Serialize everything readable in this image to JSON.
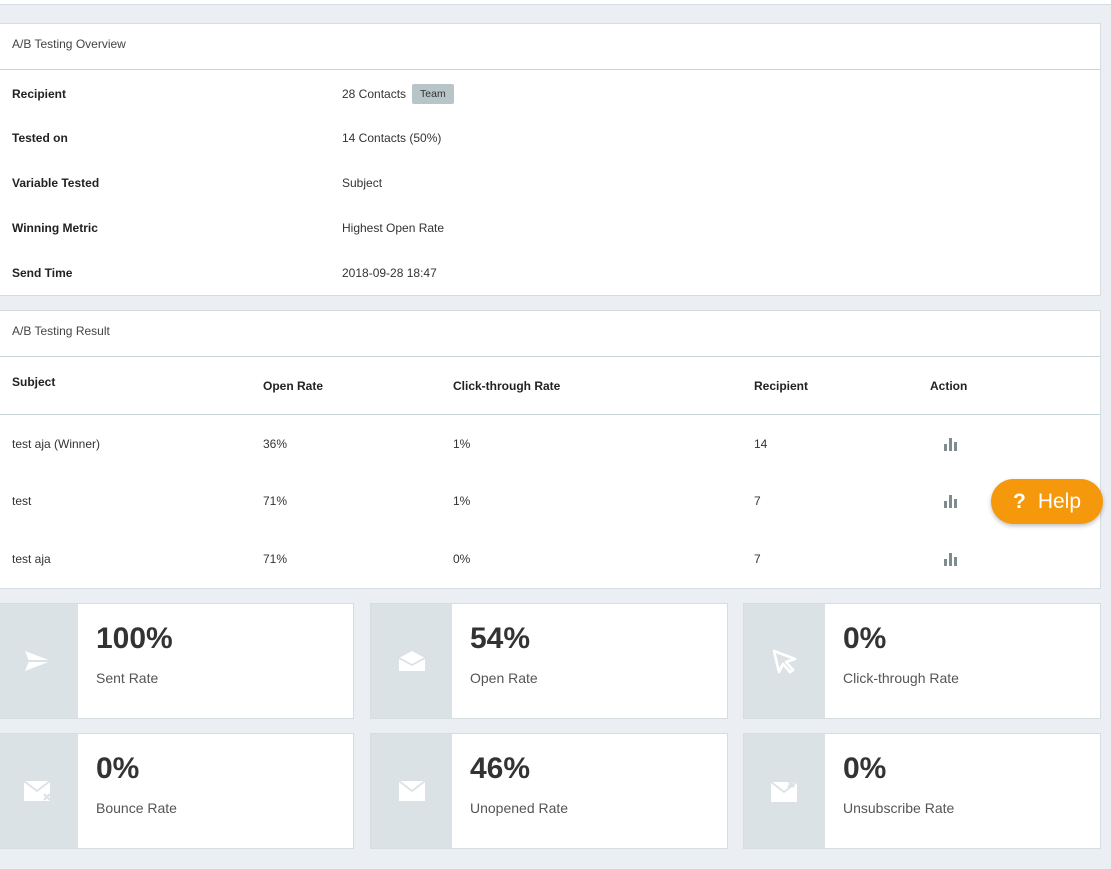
{
  "overview": {
    "title": "A/B Testing Overview",
    "rows": [
      {
        "label": "Recipient",
        "value": "28 Contacts",
        "badge": "Team"
      },
      {
        "label": "Tested on",
        "value": "14 Contacts (50%)"
      },
      {
        "label": "Variable Tested",
        "value": "Subject"
      },
      {
        "label": "Winning Metric",
        "value": "Highest Open Rate"
      },
      {
        "label": "Send Time",
        "value": "2018-09-28 18:47"
      }
    ]
  },
  "result": {
    "title": "A/B Testing Result",
    "columns": [
      "Subject",
      "Open Rate",
      "Click-through Rate",
      "Recipient",
      "Action"
    ],
    "rows": [
      {
        "subject": "test aja (Winner)",
        "open_rate": "36%",
        "ctr": "1%",
        "recipient": "14"
      },
      {
        "subject": "test",
        "open_rate": "71%",
        "ctr": "1%",
        "recipient": "7"
      },
      {
        "subject": "test aja",
        "open_rate": "71%",
        "ctr": "0%",
        "recipient": "7"
      }
    ]
  },
  "help": {
    "icon": "?",
    "label": "Help",
    "color": "#f5980b"
  },
  "stats": [
    {
      "value": "100%",
      "label": "Sent Rate",
      "icon": "paper-plane-icon"
    },
    {
      "value": "54%",
      "label": "Open Rate",
      "icon": "open-envelope-icon"
    },
    {
      "value": "0%",
      "label": "Click-through Rate",
      "icon": "cursor-icon"
    },
    {
      "value": "0%",
      "label": "Bounce Rate",
      "icon": "envelope-x-icon"
    },
    {
      "value": "46%",
      "label": "Unopened Rate",
      "icon": "envelope-icon"
    },
    {
      "value": "0%",
      "label": "Unsubscribe Rate",
      "icon": "envelope-remove-icon"
    }
  ]
}
